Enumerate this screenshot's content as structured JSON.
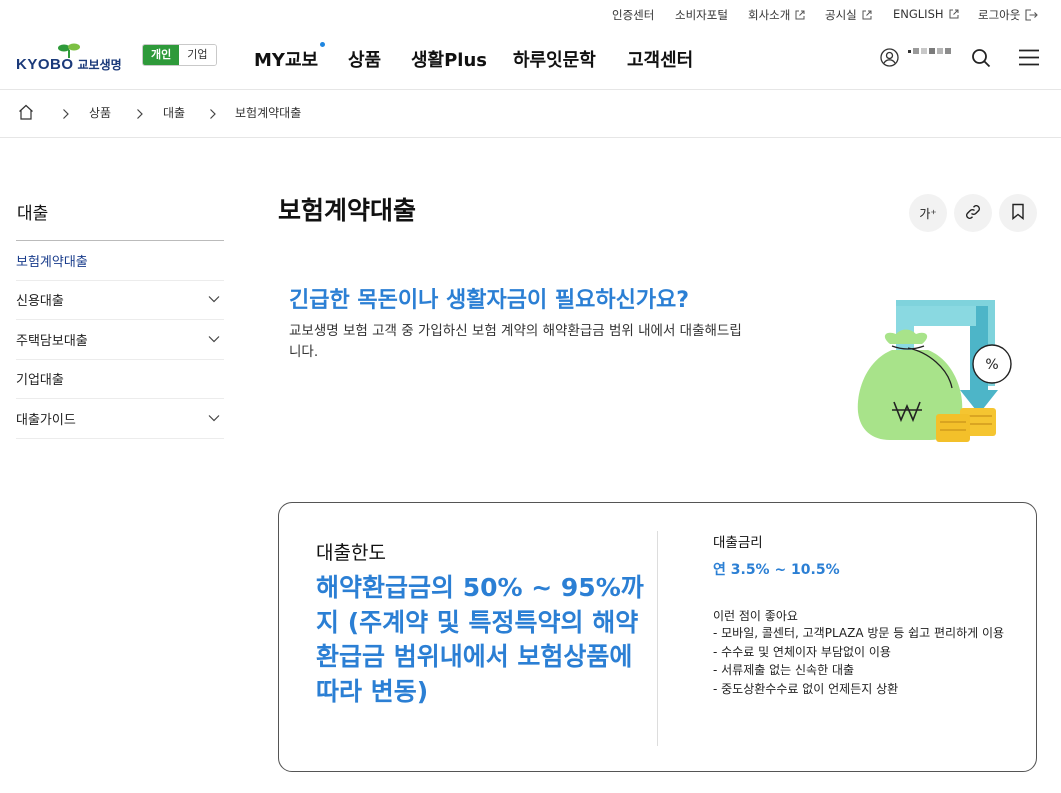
{
  "util": {
    "cert": "인증센터",
    "consumer": "소비자포털",
    "company": "회사소개",
    "notice": "공시실",
    "english": "ENGLISH",
    "logout": "로그아웃"
  },
  "header": {
    "logo_en": "KYOBO",
    "logo_kr": "교보생명",
    "segment_personal": "개인",
    "segment_corp": "기업",
    "nav": [
      "MY교보",
      "상품",
      "생활Plus",
      "하루잇문학",
      "고객센터"
    ]
  },
  "breadcrumb": [
    "상품",
    "대출",
    "보험계약대출"
  ],
  "sidebar": {
    "title": "대출",
    "items": [
      {
        "label": "보험계약대출"
      },
      {
        "label": "신용대출"
      },
      {
        "label": "주택담보대출"
      },
      {
        "label": "기업대출"
      },
      {
        "label": "대출가이드"
      }
    ]
  },
  "page": {
    "title": "보험계약대출",
    "font_tool": "가⁺"
  },
  "intro": {
    "heading": "긴급한 목돈이나 생활자금이 필요하신가요?",
    "body": "교보생명 보험 고객 중 가입하신 보험 계약의 해약환급금 범위 내에서 대출해드립니다."
  },
  "info": {
    "limit_label": "대출한도",
    "limit_value": "해약환급금의 50% ~ 95%까지 (주계약 및 특정특약의 해약환급금 범위내에서 보험상품에 따라 변동)",
    "rate_label": "대출금리",
    "rate_value": "연 3.5% ~ 10.5%",
    "benefit_title": "이런 점이 좋아요",
    "benefits": [
      "- 모바일, 콜센터, 고객PLAZA 방문 등 쉽고 편리하게 이용",
      "- 수수료 및 연체이자 부담없이 이용",
      "- 서류제출 없는 신속한 대출",
      "- 중도상환수수료 없이 언제든지 상환"
    ]
  },
  "colors": {
    "accent_blue": "#2b7fd4",
    "brand_green": "#2e9a3a",
    "brand_navy": "#1b3a7a"
  }
}
